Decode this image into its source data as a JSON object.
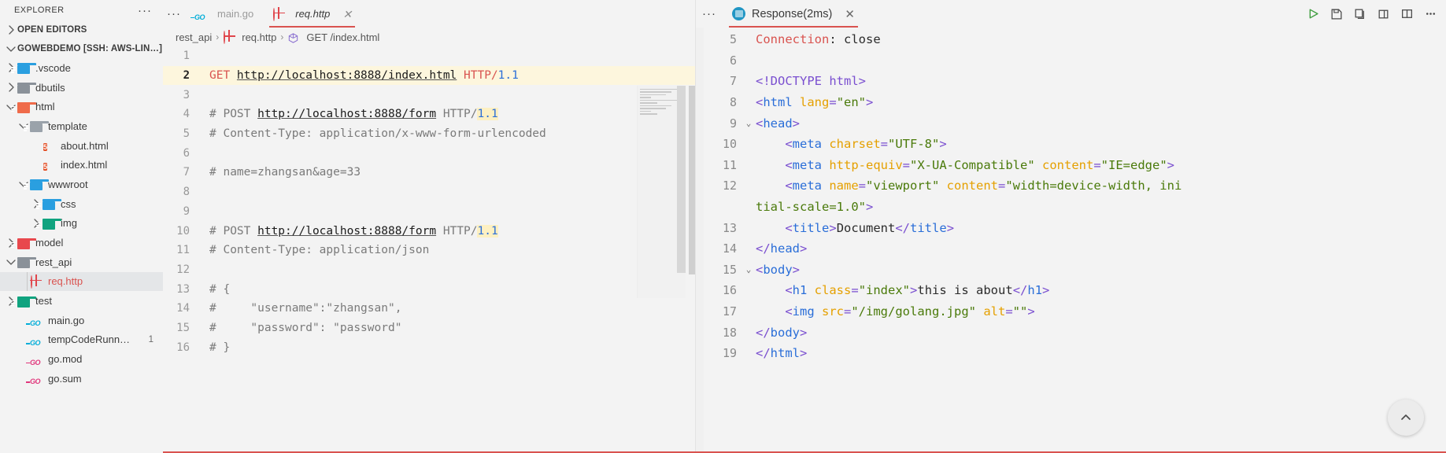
{
  "sidebar": {
    "title": "EXPLORER",
    "more_label": "···",
    "sections": [
      {
        "label": "OPEN EDITORS",
        "expanded": false
      },
      {
        "label": "GOWEBDEMO [SSH: AWS-LIN…]",
        "expanded": true
      }
    ],
    "items": [
      {
        "label": ".vscode",
        "icon": "folder-vscode-icon",
        "indent": 1,
        "arrow": "right",
        "type": "folder",
        "color": "#2a9fe0"
      },
      {
        "label": "dbutils",
        "icon": "folder-icon",
        "indent": 1,
        "arrow": "right",
        "type": "folder",
        "color": "#8a9199"
      },
      {
        "label": "html",
        "icon": "folder-html-icon",
        "indent": 1,
        "arrow": "down",
        "type": "folder",
        "color": "#ef6b4a"
      },
      {
        "label": "template",
        "icon": "folder-template-icon",
        "indent": 2,
        "arrow": "down",
        "type": "folder",
        "color": "#9aa2aa"
      },
      {
        "label": "about.html",
        "icon": "html5-icon",
        "indent": 3,
        "arrow": "none",
        "type": "file",
        "color": "#e34f26"
      },
      {
        "label": "index.html",
        "icon": "html5-icon",
        "indent": 3,
        "arrow": "none",
        "type": "file",
        "color": "#e34f26"
      },
      {
        "label": "wwwroot",
        "icon": "folder-www-icon",
        "indent": 2,
        "arrow": "down",
        "type": "folder",
        "color": "#2a9fe0"
      },
      {
        "label": "css",
        "icon": "folder-css-icon",
        "indent": 3,
        "arrow": "right",
        "type": "folder",
        "color": "#2a9fe0"
      },
      {
        "label": "img",
        "icon": "folder-img-icon",
        "indent": 3,
        "arrow": "right",
        "type": "folder",
        "color": "#10a37f"
      },
      {
        "label": "model",
        "icon": "folder-model-icon",
        "indent": 1,
        "arrow": "right",
        "type": "folder",
        "color": "#e8484d"
      },
      {
        "label": "rest_api",
        "icon": "folder-icon",
        "indent": 1,
        "arrow": "down",
        "type": "folder",
        "color": "#8a9199"
      },
      {
        "label": "req.http",
        "icon": "globe-icon",
        "indent": 2,
        "arrow": "none",
        "type": "file",
        "color": "#e0454b",
        "selected": true
      },
      {
        "label": "test",
        "icon": "folder-test-icon",
        "indent": 1,
        "arrow": "right",
        "type": "folder",
        "color": "#10a37f"
      },
      {
        "label": "main.go",
        "icon": "go-icon",
        "indent": 2,
        "arrow": "none",
        "type": "file",
        "color": "#00add8"
      },
      {
        "label": "tempCodeRunn…",
        "icon": "go-icon",
        "indent": 2,
        "arrow": "none",
        "type": "file",
        "color": "#00add8",
        "badge": "1"
      },
      {
        "label": "go.mod",
        "icon": "go-mod-icon",
        "indent": 2,
        "arrow": "none",
        "type": "file",
        "color": "#e0357b"
      },
      {
        "label": "go.sum",
        "icon": "go-mod-icon",
        "indent": 2,
        "arrow": "none",
        "type": "file",
        "color": "#e0357b"
      }
    ]
  },
  "editor": {
    "more_label": "···",
    "tabs": [
      {
        "label": "main.go",
        "icon": "go-icon",
        "active": false,
        "closable": false
      },
      {
        "label": "req.http",
        "icon": "globe-icon",
        "active": true,
        "closable": true,
        "close_label": "✕"
      }
    ],
    "breadcrumb": [
      {
        "label": "rest_api",
        "icon": "none"
      },
      {
        "label": "req.http",
        "icon": "globe-icon"
      },
      {
        "label": "GET /index.html",
        "icon": "symbol-icon"
      }
    ],
    "breadcrumb_separator": "›",
    "lines": [
      {
        "no": "1",
        "current": false,
        "highlight": false,
        "tokens": []
      },
      {
        "no": "2",
        "current": true,
        "highlight": true,
        "tokens": [
          {
            "t": "GET ",
            "c": "kw-get"
          },
          {
            "t": "http://localhost:8888/index.html",
            "c": "url"
          },
          {
            "t": " ",
            "c": "plain"
          },
          {
            "t": "HTTP/",
            "c": "proto"
          },
          {
            "t": "1.1",
            "c": "ver"
          }
        ]
      },
      {
        "no": "3",
        "current": false,
        "highlight": false,
        "tokens": []
      },
      {
        "no": "4",
        "current": false,
        "highlight": false,
        "tokens": [
          {
            "t": "# POST ",
            "c": "cm"
          },
          {
            "t": "http://localhost:8888/form",
            "c": "url"
          },
          {
            "t": " HTTP/",
            "c": "cm"
          },
          {
            "t": "1.1",
            "c": "ver hl-tok"
          }
        ]
      },
      {
        "no": "5",
        "current": false,
        "highlight": false,
        "tokens": [
          {
            "t": "# Content-Type: application/x-www-form-urlencoded",
            "c": "cm"
          }
        ]
      },
      {
        "no": "6",
        "current": false,
        "highlight": false,
        "tokens": []
      },
      {
        "no": "7",
        "current": false,
        "highlight": false,
        "tokens": [
          {
            "t": "# name=zhangsan&age=33",
            "c": "cm"
          }
        ]
      },
      {
        "no": "8",
        "current": false,
        "highlight": false,
        "tokens": []
      },
      {
        "no": "9",
        "current": false,
        "highlight": false,
        "tokens": []
      },
      {
        "no": "10",
        "current": false,
        "highlight": false,
        "tokens": [
          {
            "t": "# POST ",
            "c": "cm"
          },
          {
            "t": "http://localhost:8888/form",
            "c": "url"
          },
          {
            "t": " HTTP/",
            "c": "cm"
          },
          {
            "t": "1.1",
            "c": "ver hl-tok"
          }
        ]
      },
      {
        "no": "11",
        "current": false,
        "highlight": false,
        "tokens": [
          {
            "t": "# Content-Type: application/json",
            "c": "cm"
          }
        ]
      },
      {
        "no": "12",
        "current": false,
        "highlight": false,
        "tokens": []
      },
      {
        "no": "13",
        "current": false,
        "highlight": false,
        "tokens": [
          {
            "t": "# {",
            "c": "cm"
          }
        ]
      },
      {
        "no": "14",
        "current": false,
        "highlight": false,
        "tokens": [
          {
            "t": "#     \"username\":\"zhangsan\",",
            "c": "cm"
          }
        ]
      },
      {
        "no": "15",
        "current": false,
        "highlight": false,
        "tokens": [
          {
            "t": "#     \"password\": \"password\"",
            "c": "cm"
          }
        ]
      },
      {
        "no": "16",
        "current": false,
        "highlight": false,
        "tokens": [
          {
            "t": "# }",
            "c": "cm"
          }
        ]
      }
    ]
  },
  "response": {
    "more_label": "···",
    "tab_label": "Response(2ms)",
    "tab_close_label": "✕",
    "tab_icon": "json-icon",
    "toolbar": [
      {
        "name": "run-icon",
        "glyph": "run"
      },
      {
        "name": "save-icon",
        "glyph": "save"
      },
      {
        "name": "copy-icon",
        "glyph": "copy"
      },
      {
        "name": "open-pane-icon",
        "glyph": "open"
      },
      {
        "name": "split-editor-icon",
        "glyph": "split"
      },
      {
        "name": "more-actions-icon",
        "glyph": "dots"
      }
    ],
    "fab_label": "↑",
    "lines": [
      {
        "no": "5",
        "fold": "",
        "tokens": [
          {
            "t": "Connection",
            "c": "t-hdr"
          },
          {
            "t": ": close",
            "c": "t-text"
          }
        ]
      },
      {
        "no": "6",
        "fold": "",
        "tokens": []
      },
      {
        "no": "7",
        "fold": "",
        "tokens": [
          {
            "t": "<!DOCTYPE html>",
            "c": "t-dt"
          }
        ]
      },
      {
        "no": "8",
        "fold": "",
        "tokens": [
          {
            "t": "<",
            "c": "t-brack"
          },
          {
            "t": "html ",
            "c": "t-tag"
          },
          {
            "t": "lang",
            "c": "t-attr"
          },
          {
            "t": "=",
            "c": "t-brack"
          },
          {
            "t": "\"en\"",
            "c": "t-str"
          },
          {
            "t": ">",
            "c": "t-brack"
          }
        ]
      },
      {
        "no": "9",
        "fold": "⌄",
        "tokens": [
          {
            "t": "<",
            "c": "t-brack"
          },
          {
            "t": "head",
            "c": "t-tag"
          },
          {
            "t": ">",
            "c": "t-brack"
          }
        ]
      },
      {
        "no": "10",
        "fold": "",
        "tokens": [
          {
            "t": "    <",
            "c": "t-brack"
          },
          {
            "t": "meta ",
            "c": "t-tag"
          },
          {
            "t": "charset",
            "c": "t-attr"
          },
          {
            "t": "=",
            "c": "t-brack"
          },
          {
            "t": "\"UTF-8\"",
            "c": "t-str"
          },
          {
            "t": ">",
            "c": "t-brack"
          }
        ]
      },
      {
        "no": "11",
        "fold": "",
        "tokens": [
          {
            "t": "    <",
            "c": "t-brack"
          },
          {
            "t": "meta ",
            "c": "t-tag"
          },
          {
            "t": "http-equiv",
            "c": "t-attr"
          },
          {
            "t": "=",
            "c": "t-brack"
          },
          {
            "t": "\"X-UA-Compatible\" ",
            "c": "t-str"
          },
          {
            "t": "content",
            "c": "t-attr"
          },
          {
            "t": "=",
            "c": "t-brack"
          },
          {
            "t": "\"IE=edge\"",
            "c": "t-str"
          },
          {
            "t": ">",
            "c": "t-brack"
          }
        ]
      },
      {
        "no": "12",
        "fold": "",
        "tokens": [
          {
            "t": "    <",
            "c": "t-brack"
          },
          {
            "t": "meta ",
            "c": "t-tag"
          },
          {
            "t": "name",
            "c": "t-attr"
          },
          {
            "t": "=",
            "c": "t-brack"
          },
          {
            "t": "\"viewport\" ",
            "c": "t-str"
          },
          {
            "t": "content",
            "c": "t-attr"
          },
          {
            "t": "=",
            "c": "t-brack"
          },
          {
            "t": "\"width=device-width, ini",
            "c": "t-str"
          }
        ]
      },
      {
        "no": "",
        "fold": "",
        "wrap": true,
        "tokens": [
          {
            "t": "tial-scale=1.0\"",
            "c": "t-str"
          },
          {
            "t": ">",
            "c": "t-brack"
          }
        ]
      },
      {
        "no": "13",
        "fold": "",
        "tokens": [
          {
            "t": "    <",
            "c": "t-brack"
          },
          {
            "t": "title",
            "c": "t-tag"
          },
          {
            "t": ">",
            "c": "t-brack"
          },
          {
            "t": "Document",
            "c": "t-text"
          },
          {
            "t": "</",
            "c": "t-brack"
          },
          {
            "t": "title",
            "c": "t-tag"
          },
          {
            "t": ">",
            "c": "t-brack"
          }
        ]
      },
      {
        "no": "14",
        "fold": "",
        "tokens": [
          {
            "t": "</",
            "c": "t-brack"
          },
          {
            "t": "head",
            "c": "t-tag"
          },
          {
            "t": ">",
            "c": "t-brack"
          }
        ]
      },
      {
        "no": "15",
        "fold": "⌄",
        "tokens": [
          {
            "t": "<",
            "c": "t-brack"
          },
          {
            "t": "body",
            "c": "t-tag"
          },
          {
            "t": ">",
            "c": "t-brack"
          }
        ]
      },
      {
        "no": "16",
        "fold": "",
        "tokens": [
          {
            "t": "    <",
            "c": "t-brack"
          },
          {
            "t": "h1 ",
            "c": "t-tag"
          },
          {
            "t": "class",
            "c": "t-attr"
          },
          {
            "t": "=",
            "c": "t-brack"
          },
          {
            "t": "\"index\"",
            "c": "t-str"
          },
          {
            "t": ">",
            "c": "t-brack"
          },
          {
            "t": "this is about",
            "c": "t-text"
          },
          {
            "t": "</",
            "c": "t-brack"
          },
          {
            "t": "h1",
            "c": "t-tag"
          },
          {
            "t": ">",
            "c": "t-brack"
          }
        ]
      },
      {
        "no": "17",
        "fold": "",
        "tokens": [
          {
            "t": "    <",
            "c": "t-brack"
          },
          {
            "t": "img ",
            "c": "t-tag"
          },
          {
            "t": "src",
            "c": "t-attr"
          },
          {
            "t": "=",
            "c": "t-brack"
          },
          {
            "t": "\"/img/golang.jpg\" ",
            "c": "t-str"
          },
          {
            "t": "alt",
            "c": "t-attr"
          },
          {
            "t": "=",
            "c": "t-brack"
          },
          {
            "t": "\"\"",
            "c": "t-str"
          },
          {
            "t": ">",
            "c": "t-brack"
          }
        ]
      },
      {
        "no": "18",
        "fold": "",
        "tokens": [
          {
            "t": "</",
            "c": "t-brack"
          },
          {
            "t": "body",
            "c": "t-tag"
          },
          {
            "t": ">",
            "c": "t-brack"
          }
        ]
      },
      {
        "no": "19",
        "fold": "",
        "tokens": [
          {
            "t": "</",
            "c": "t-brack"
          },
          {
            "t": "html",
            "c": "t-tag"
          },
          {
            "t": ">",
            "c": "t-brack"
          }
        ]
      }
    ]
  },
  "colors": {
    "accent": "#d9534f",
    "background": "#f3f3f3",
    "selection": "#e4e6e8",
    "highlight": "#fdf6dd"
  }
}
